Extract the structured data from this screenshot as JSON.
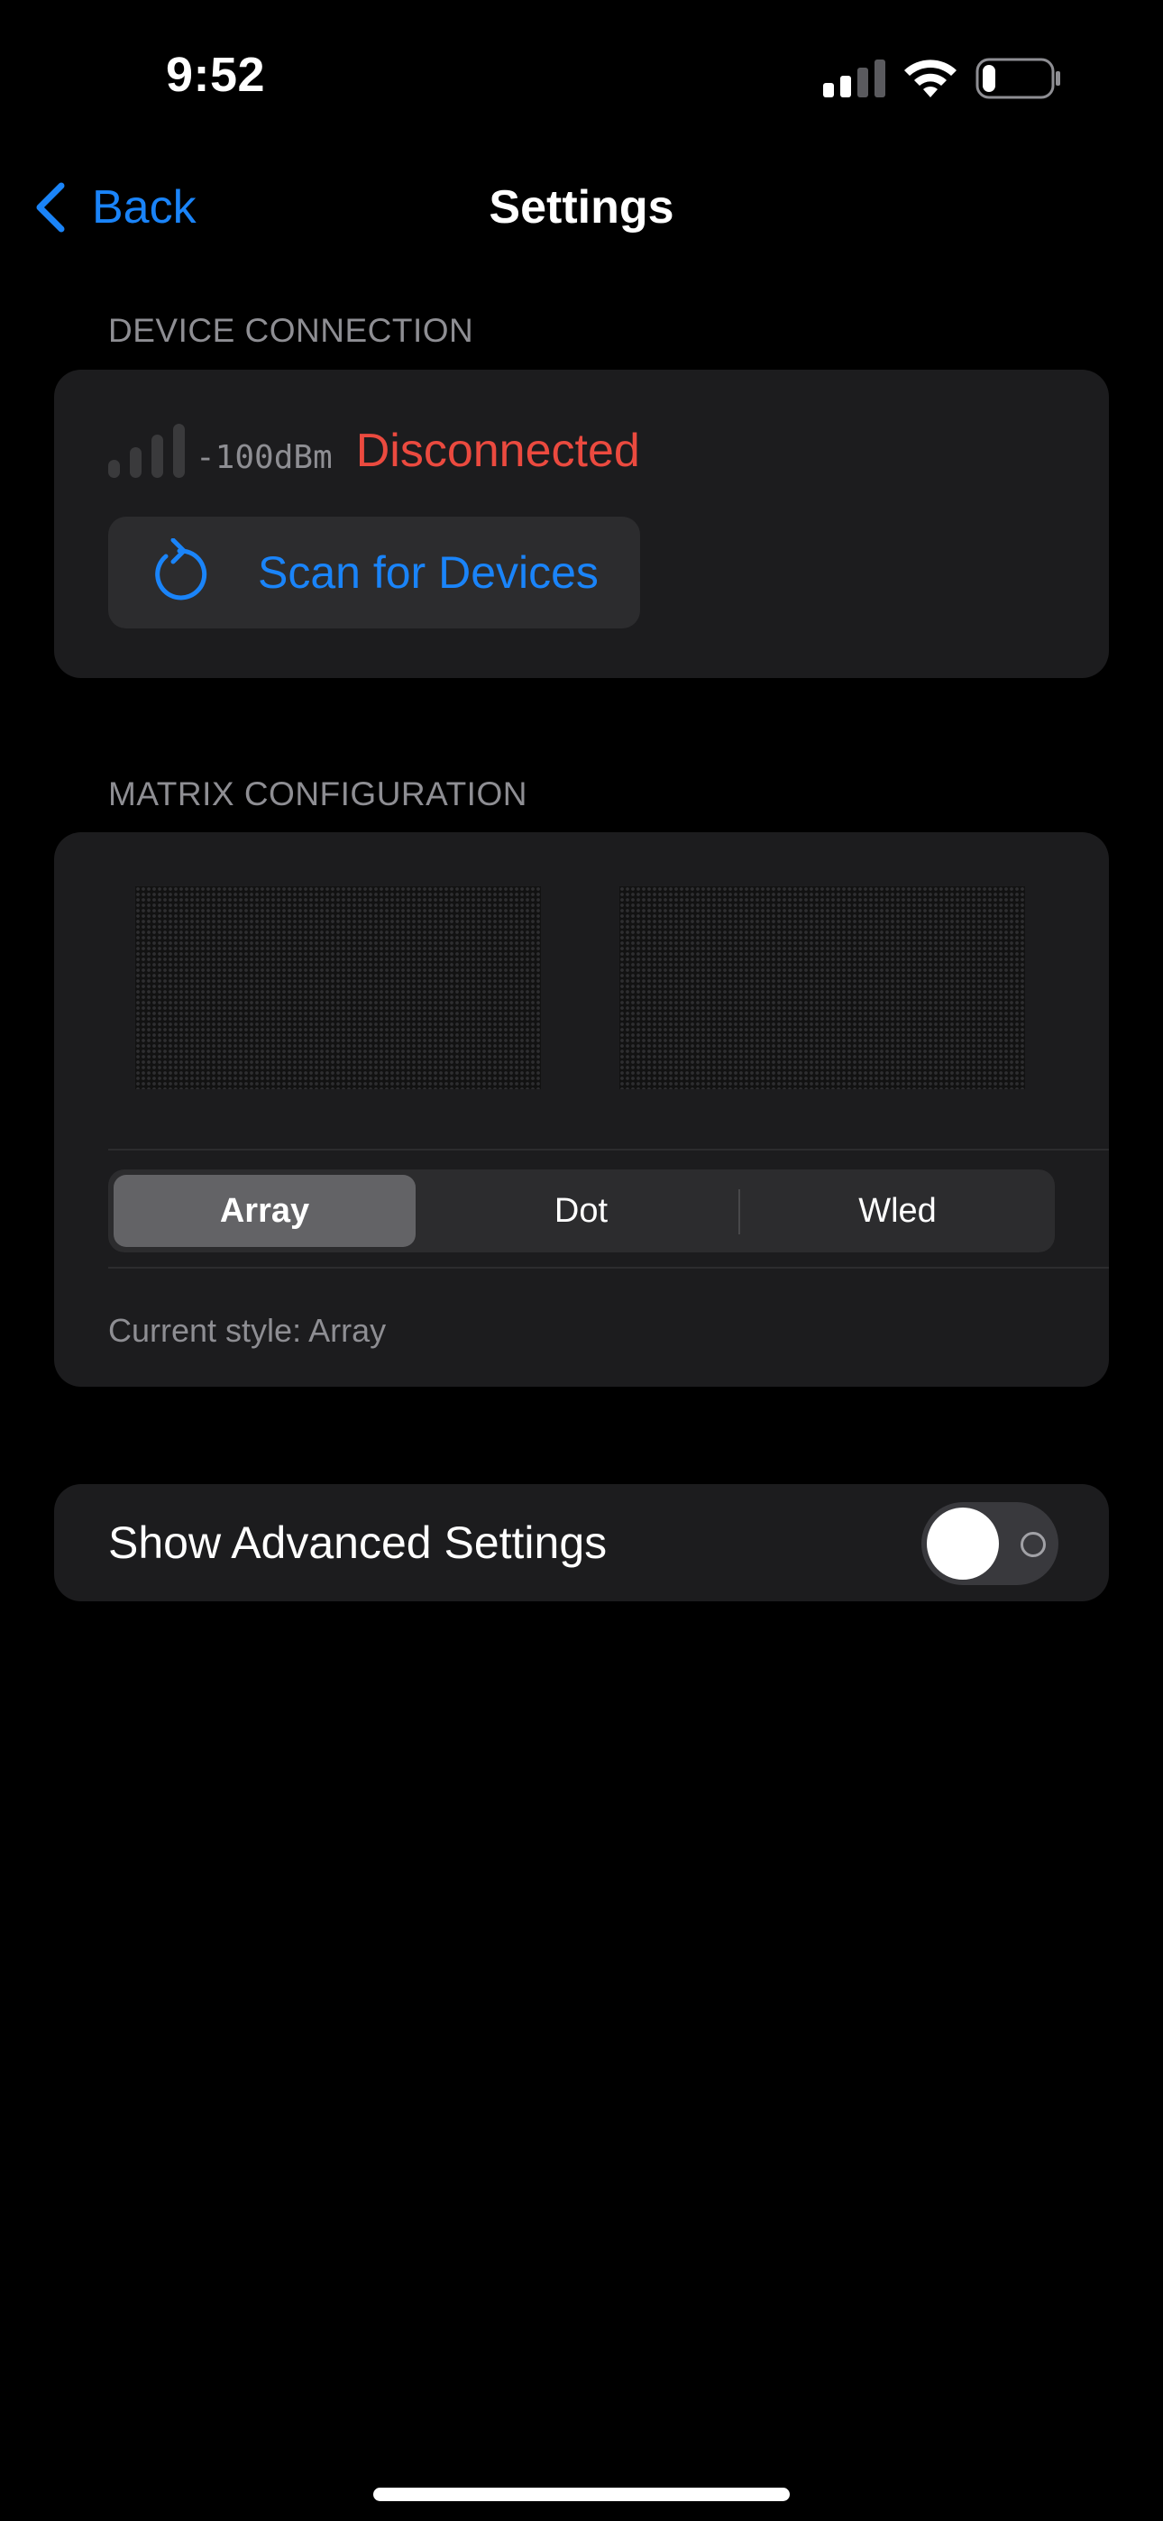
{
  "status_bar": {
    "time": "9:52",
    "icons": [
      "cellular-signal-icon",
      "wifi-icon",
      "battery-icon"
    ],
    "battery_level": 0.2
  },
  "nav": {
    "back_label": "Back",
    "back_icon": "chevron-left-icon",
    "title": "Settings"
  },
  "device_connection": {
    "header": "DEVICE CONNECTION",
    "signal_strength": "-100dBm",
    "signal_bars_active": 0,
    "status": "Disconnected",
    "scan_button_label": "Scan for Devices",
    "scan_icon": "refresh-icon"
  },
  "matrix_configuration": {
    "header": "MATRIX CONFIGURATION",
    "previews": [
      "matrix-preview-left",
      "matrix-preview-right"
    ],
    "style_options": [
      "Array",
      "Dot",
      "Wled"
    ],
    "selected_style": "Array",
    "current_style_text": "Current style: Array"
  },
  "advanced": {
    "label": "Show Advanced Settings",
    "enabled": false
  },
  "colors": {
    "accent": "#1a84f9",
    "error": "#eb4a3f",
    "card_background": "#1c1c1e",
    "secondary_text": "#8e8e93"
  }
}
